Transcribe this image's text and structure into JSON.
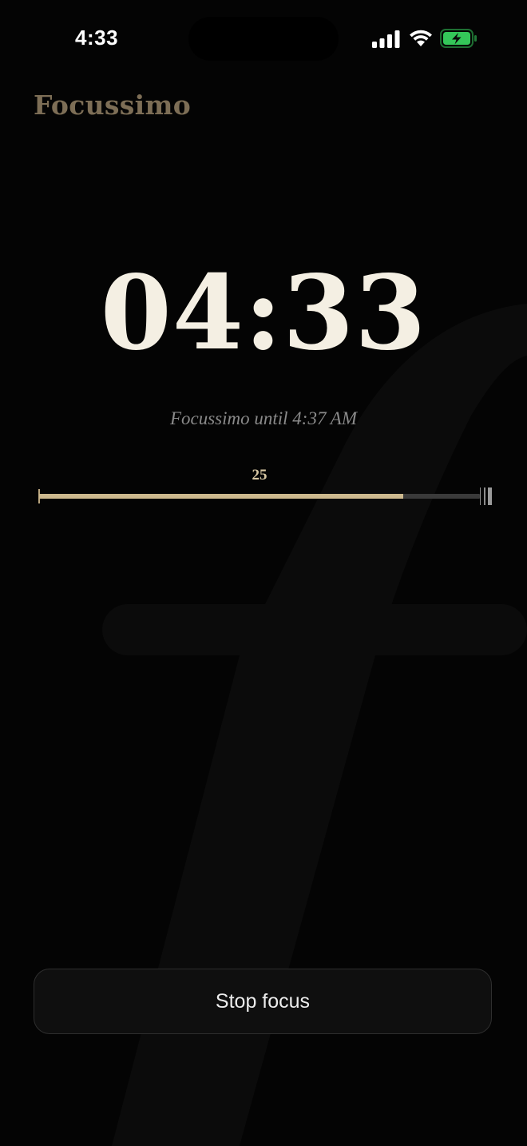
{
  "status_bar": {
    "time": "4:33",
    "icons": [
      "signal-icon",
      "wifi-icon",
      "battery-charging-icon"
    ],
    "battery_color": "#34c759"
  },
  "app": {
    "title": "Focussimo"
  },
  "timer": {
    "display": "04:33",
    "until": "Focussimo until 4:37 AM"
  },
  "progress": {
    "label": "25",
    "fraction": 0.826
  },
  "actions": {
    "stop_label": "Stop focus"
  },
  "colors": {
    "accent": "#cdb98e",
    "title": "#7d6e56",
    "timer": "#f4efe3",
    "background": "#040404"
  }
}
